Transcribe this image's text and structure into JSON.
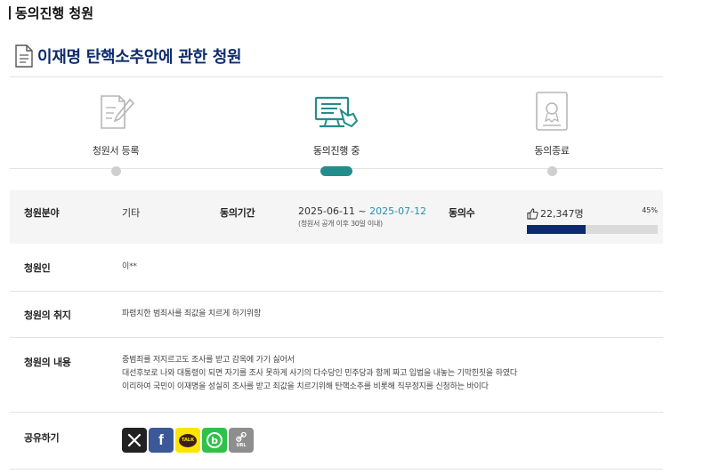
{
  "section": {
    "title": "동의진행 청원"
  },
  "petition": {
    "title": "이재명 탄핵소추안에 관한 청원"
  },
  "steps": [
    {
      "label": "청원서 등록",
      "icon": "pen-document-icon",
      "active": false
    },
    {
      "label": "동의진행 중",
      "icon": "monitor-hand-icon",
      "active": true
    },
    {
      "label": "동의종료",
      "icon": "certificate-icon",
      "active": false
    }
  ],
  "info": {
    "field_label": "청원분야",
    "field_value": "기타",
    "period_label": "동의기간",
    "period_start": "2025-06-11",
    "period_sep": " ~ ",
    "period_end": "2025-07-12",
    "period_note": "(청원서 공개 이후 30일 이내)",
    "count_label": "동의수",
    "count_value": "22,347명",
    "percent_text": "45%",
    "progress": 0.45
  },
  "petitioner": {
    "label": "청원인",
    "value": "이**"
  },
  "purpose": {
    "label": "청원의 취지",
    "value": "파렴치한 범죄사를 죄값을 치르게 하기위함"
  },
  "content": {
    "label": "청원의 내용",
    "lines": [
      "중범죄를 저지르고도 조사를 받고 감옥에 가기 싫어서",
      "대선후보로 나와 대통령이 되면 자기를 조사 못하게 사기의 다수당인 민주당과 함께 짜고 입법을 내놓는 기막힌짓을 하였다",
      "이리하여 국민이 이재명을 성실히 조사를 받고 죄값을 치르기위해 탄핵소추를 비롯해 직무정지를 신청하는 바이다"
    ]
  },
  "share": {
    "label": "공유하기",
    "buttons": [
      {
        "name": "share-x-button",
        "icon": "x-logo-icon",
        "color": "#222222",
        "text": ""
      },
      {
        "name": "share-facebook-button",
        "icon": "facebook-logo-icon",
        "color": "#3b5998",
        "text": "f"
      },
      {
        "name": "share-kakaotalk-button",
        "icon": "kakaotalk-logo-icon",
        "color": "#fee500",
        "text": "TALK"
      },
      {
        "name": "share-band-button",
        "icon": "band-logo-icon",
        "color": "#2fc14a",
        "text": "b"
      },
      {
        "name": "share-url-button",
        "icon": "link-icon",
        "color": "#8e8e8e",
        "text": "URL"
      }
    ]
  },
  "colors": {
    "title": "#0d2c6c",
    "accent": "#238d8b",
    "progress": "#0e2a6e",
    "period_end": "#2a8fb0"
  }
}
